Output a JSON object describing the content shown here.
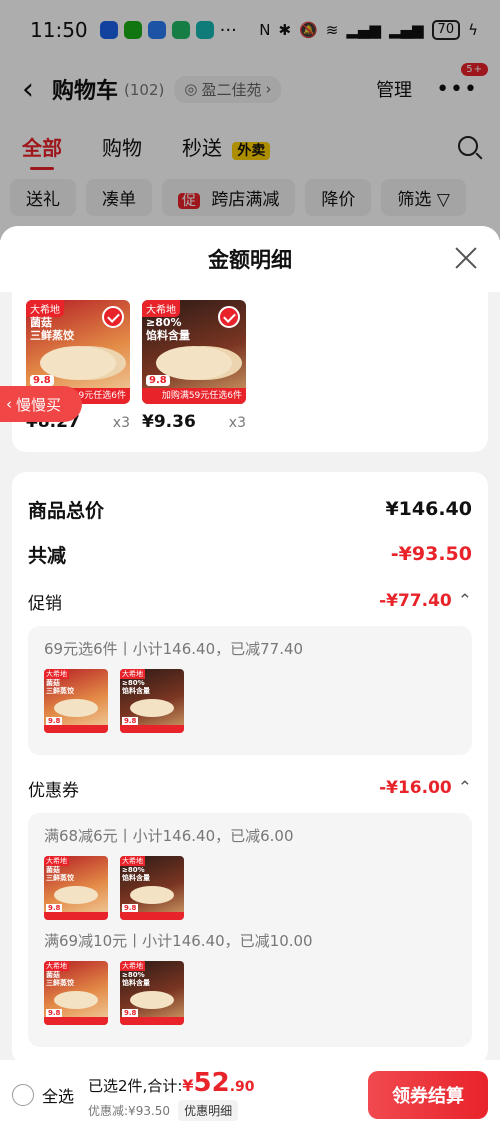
{
  "status_bar": {
    "time": "11:50",
    "battery": "70"
  },
  "header": {
    "title": "购物车",
    "count": "(102)",
    "location": "盈二佳苑",
    "manage_label": "管理",
    "more_badge": "5+"
  },
  "tabs": [
    {
      "label": "全部"
    },
    {
      "label": "购物"
    },
    {
      "label": "秒送",
      "badge": "外卖"
    }
  ],
  "chips": [
    {
      "label": "送礼"
    },
    {
      "label": "凑单"
    },
    {
      "tag": "促",
      "label": "跨店满减"
    },
    {
      "label": "降价"
    },
    {
      "label": "筛选"
    }
  ],
  "sheet": {
    "title": "金额明细",
    "slow_buy_label": "慢慢买",
    "products": [
      {
        "brand": "大希地",
        "caption": "菌菇\n三鲜蒸饺",
        "stamp": "9.8",
        "promo": "加购满59元任选6件",
        "price": "¥8.27",
        "qty": "x3"
      },
      {
        "brand": "大希地",
        "caption": "≥80%\n馅料含量",
        "stamp": "9.8",
        "promo": "加购满59元任选6件",
        "price": "¥9.36",
        "qty": "x3"
      }
    ],
    "total_label": "商品总价",
    "total_value": "¥146.40",
    "reduce_label": "共减",
    "reduce_value": "-¥93.50",
    "promo_label": "促销",
    "promo_value": "-¥77.40",
    "promo_groups": [
      {
        "line": "69元选6件丨小计146.40，已减77.40"
      }
    ],
    "coupon_label": "优惠券",
    "coupon_value": "-¥16.00",
    "coupon_groups": [
      {
        "line": "满68减6元丨小计146.40，已减6.00"
      },
      {
        "line": "满69减10元丨小计146.40，已减10.00"
      }
    ],
    "thumb_brand": "大希地",
    "thumb_caption_1": "菌菇\n三鲜蒸饺",
    "thumb_caption_2": "≥80%\n馅料含量",
    "thumb_stamp": "9.8"
  },
  "bottom_bar": {
    "select_all": "全选",
    "selected_text": "已选2件,合计:",
    "currency": "¥",
    "total_int": "52",
    "total_dec": ".90",
    "discount_text": "优惠减:¥93.50",
    "detail_label": "优惠明细",
    "checkout_label": "领券结算"
  }
}
